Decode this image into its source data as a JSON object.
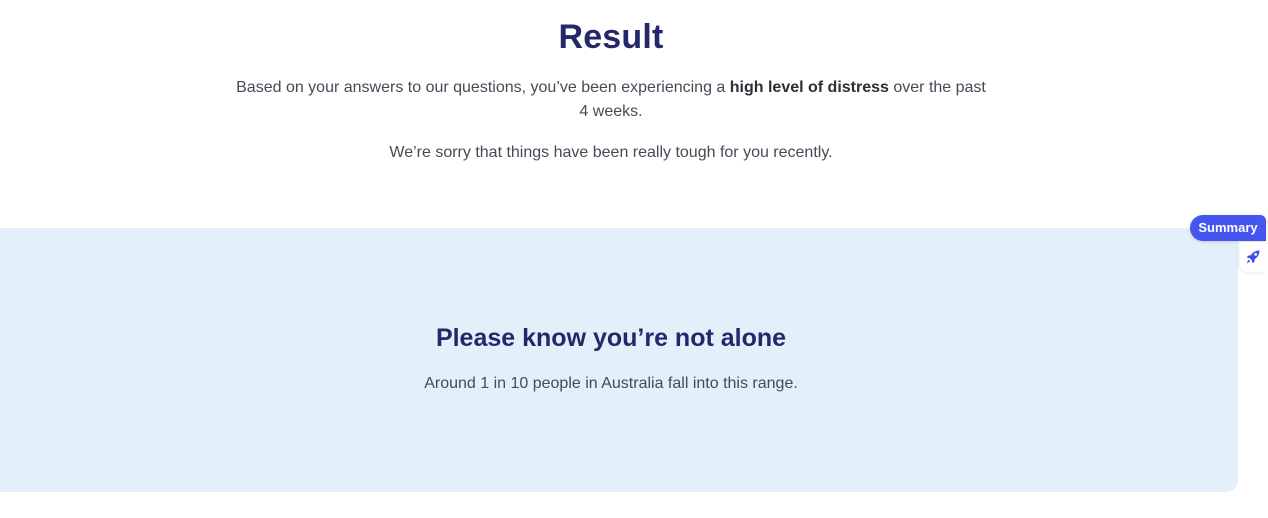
{
  "result": {
    "title": "Result",
    "para1_before": "Based on your answers to our questions, you’ve been experiencing a ",
    "para1_bold": "high level of distress",
    "para1_after": " over the past 4 weeks.",
    "para2": "We’re sorry that things have been really tough for you recently."
  },
  "alone": {
    "title": "Please know you’re not alone",
    "text": "Around 1 in 10 people in Australia fall into this range."
  },
  "side_widget": {
    "summary_label": "Summary",
    "rocket_icon": "rocket-icon"
  },
  "colors": {
    "heading": "#24286b",
    "body_text": "#464a55",
    "panel_bg": "#e3effb",
    "accent": "#4455f0"
  }
}
